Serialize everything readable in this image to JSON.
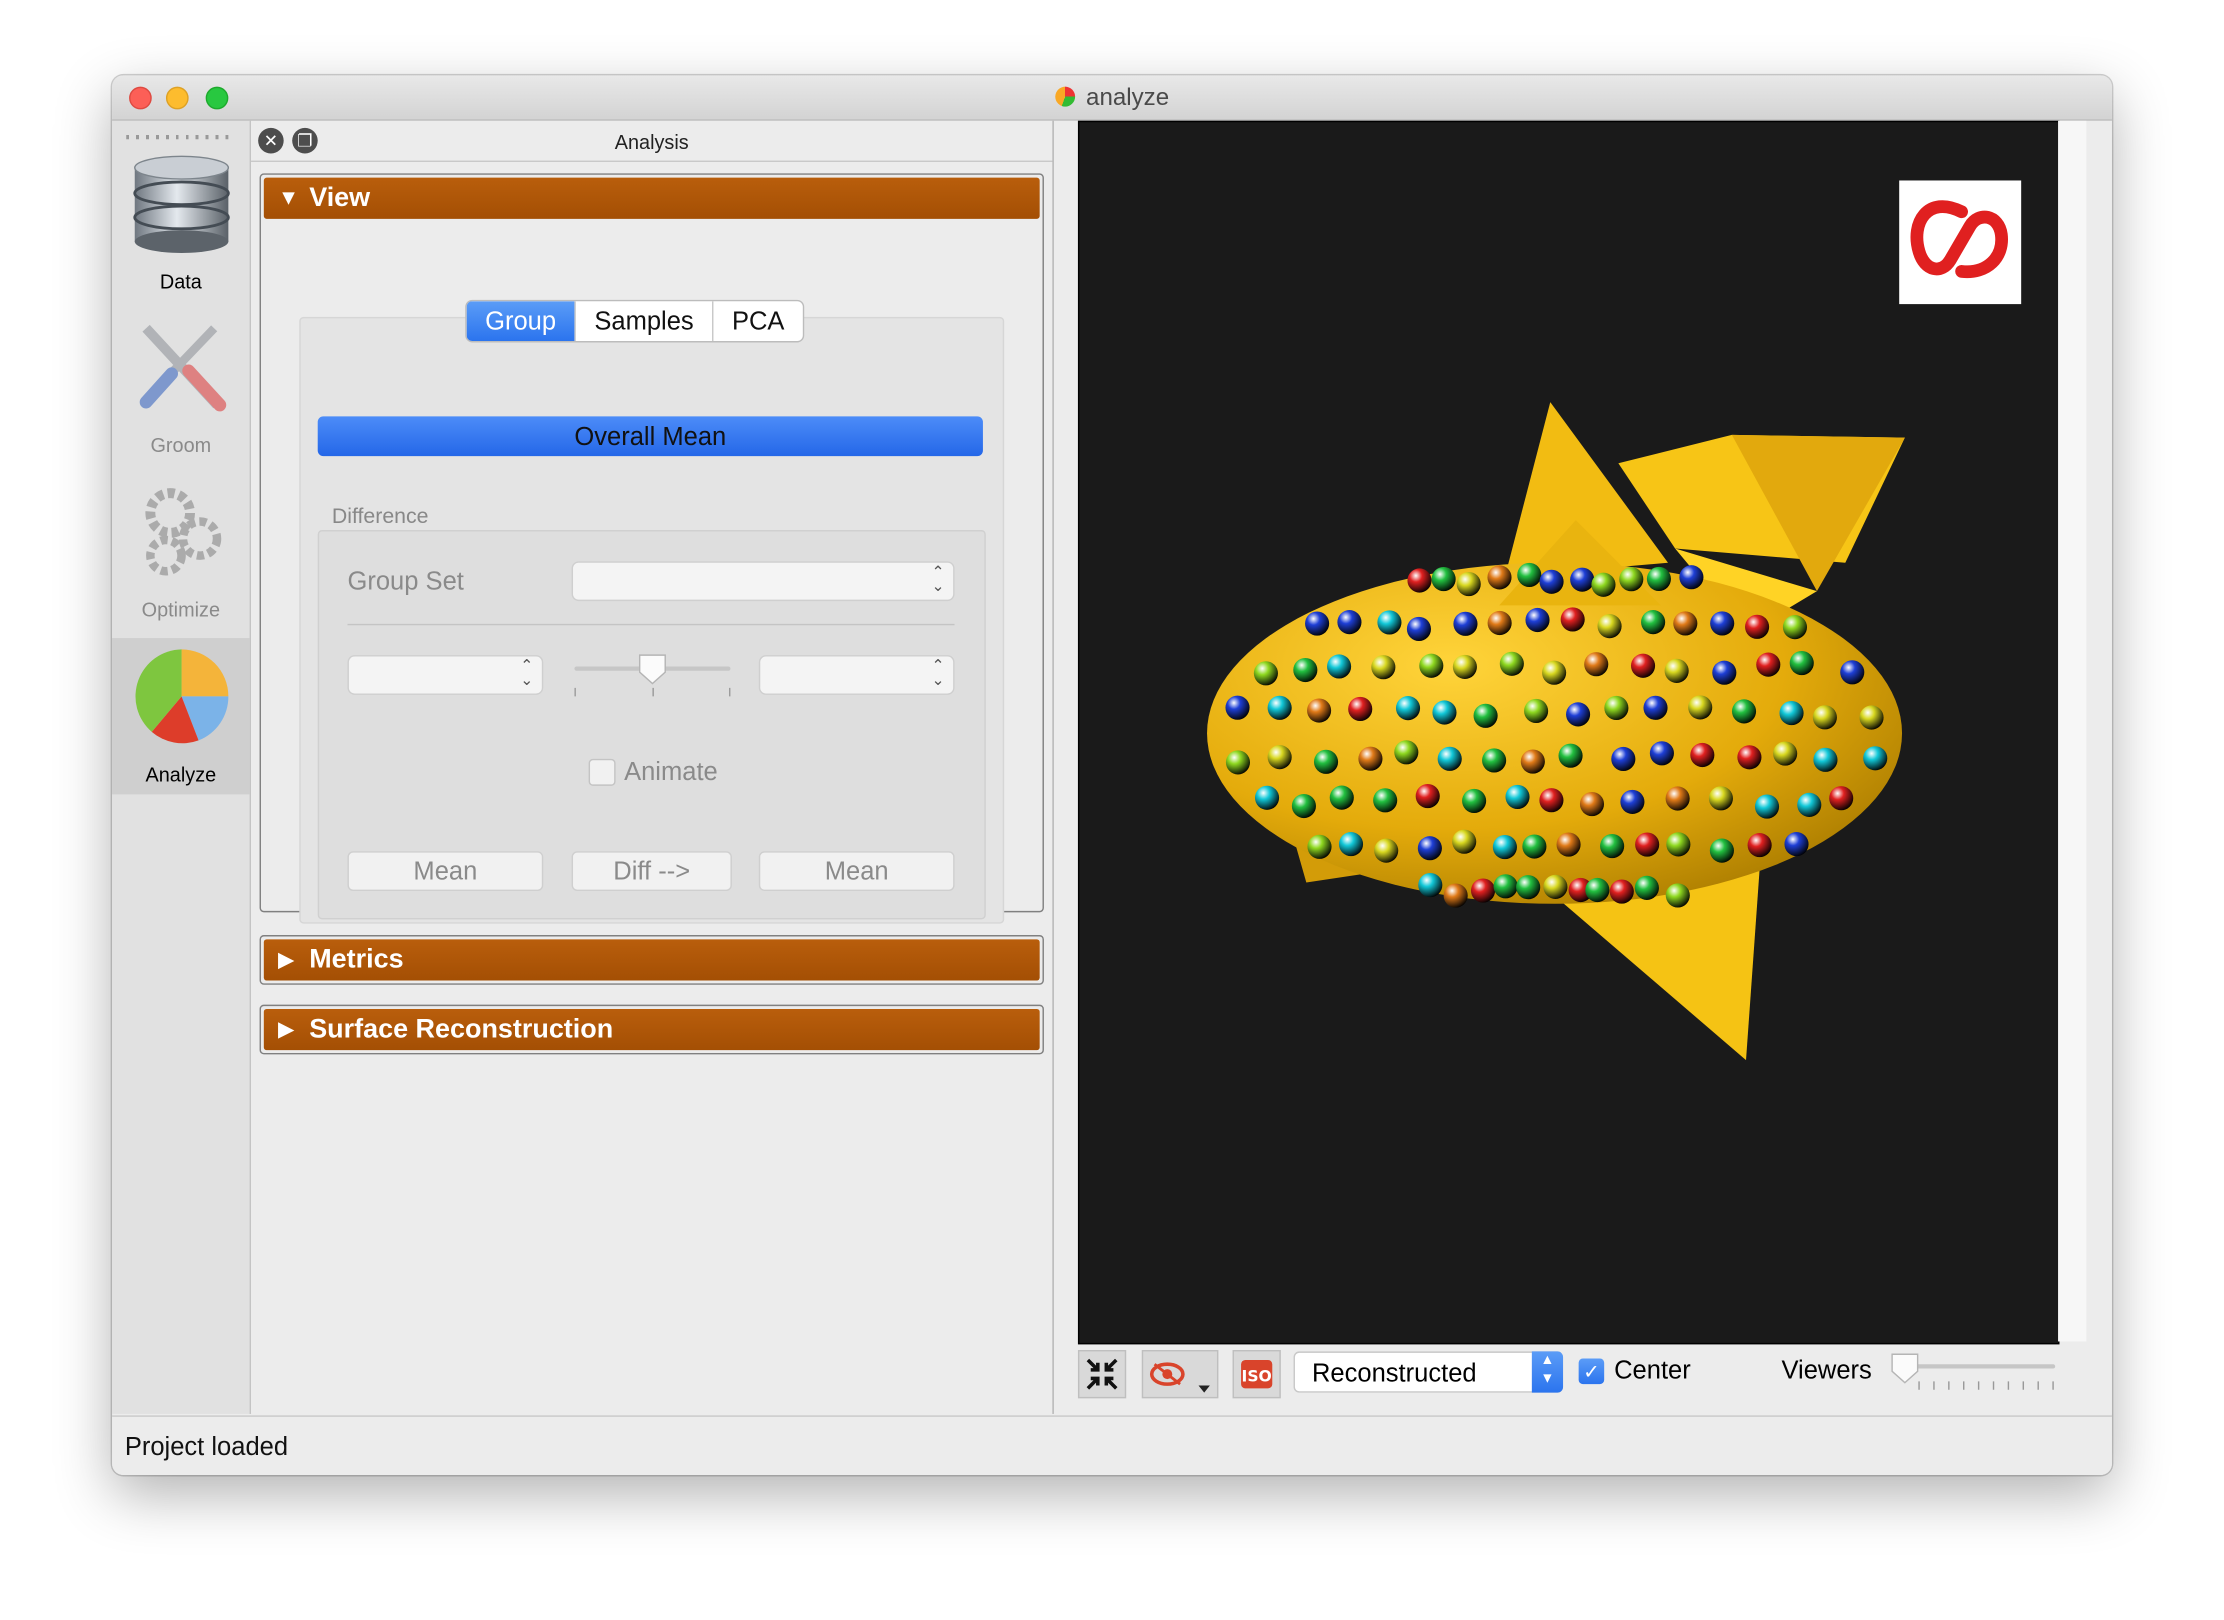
{
  "window": {
    "title": "analyze"
  },
  "toolbar": {
    "items": [
      {
        "label": "Data",
        "enabled": true
      },
      {
        "label": "Groom",
        "enabled": false
      },
      {
        "label": "Optimize",
        "enabled": false
      },
      {
        "label": "Analyze",
        "enabled": true,
        "active": true
      }
    ]
  },
  "panel": {
    "title": "Analysis",
    "view": {
      "title": "View",
      "tabs": [
        {
          "label": "Group",
          "active": true
        },
        {
          "label": "Samples"
        },
        {
          "label": "PCA"
        }
      ],
      "overall_mean_button": "Overall Mean",
      "difference_label": "Difference",
      "group_set_label": "Group Set",
      "group_set_value": "",
      "left_group_value": "",
      "right_group_value": "",
      "slider_value": 0.5,
      "animate_label": "Animate",
      "animate_checked": false,
      "mean_left_button": "Mean",
      "diff_button": "Diff -->",
      "mean_right_button": "Mean"
    },
    "metrics": {
      "title": "Metrics"
    },
    "surface": {
      "title": "Surface Reconstruction"
    }
  },
  "viewer": {
    "display_mode": "Reconstructed",
    "center_label": "Center",
    "center_checked": true,
    "viewers_label": "Viewers",
    "viewers_value": 1,
    "tool_icons": [
      "collapse-arrows-icon",
      "eye-icon",
      "iso-icon"
    ]
  },
  "status": {
    "text": "Project loaded"
  },
  "colors": {
    "section_bar": "#a94f04",
    "accent_blue": "#2b74ee",
    "viewport_bg": "#1a1a1a",
    "shape_gold": "#e8b012",
    "logo_red": "#e02020"
  }
}
